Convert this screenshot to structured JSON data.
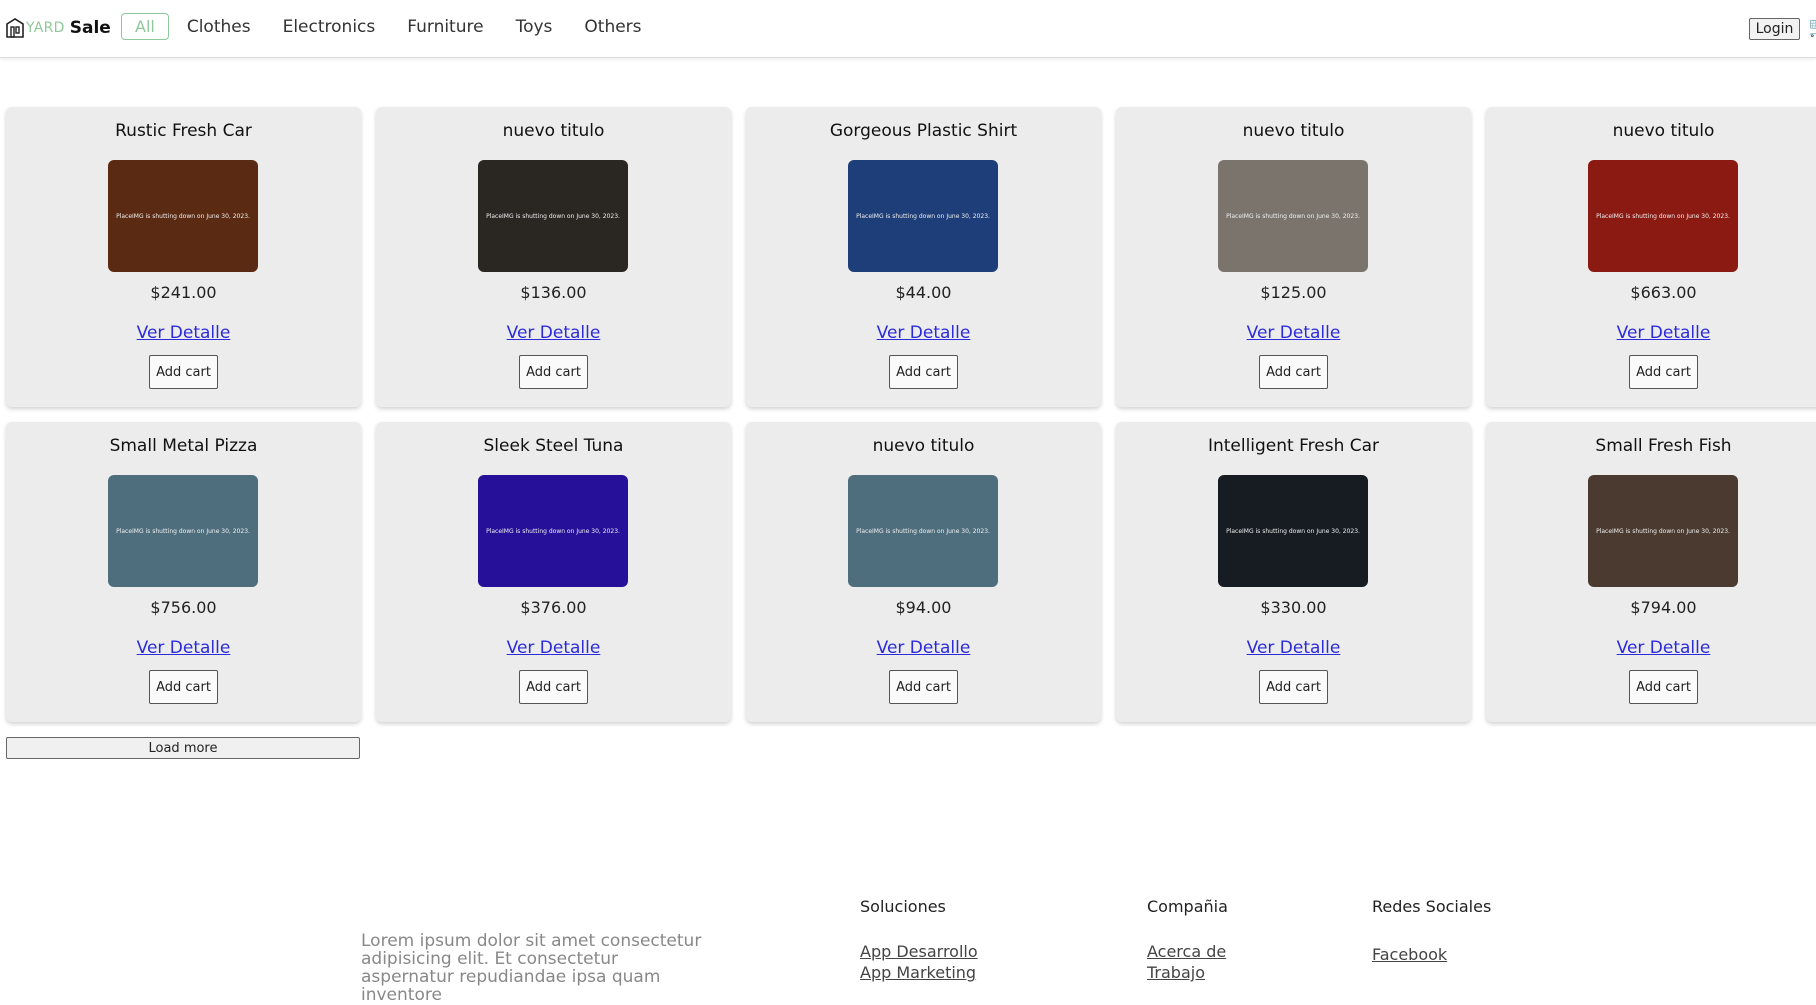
{
  "header": {
    "logo_yard": "YARD",
    "logo_sale": "Sale",
    "nav": [
      "All",
      "Clothes",
      "Electronics",
      "Furniture",
      "Toys",
      "Others"
    ],
    "login": "Login"
  },
  "products": [
    {
      "title": "Rustic Fresh Car",
      "price": "$241.00",
      "link": "Ver Detalle",
      "button": "Add cart",
      "img_text": "PlaceIMG is shutting down on June 30, 2023.",
      "bg": "#5a2a12"
    },
    {
      "title": "nuevo titulo",
      "price": "$136.00",
      "link": "Ver Detalle",
      "button": "Add cart",
      "img_text": "PlaceIMG is shutting down on June 30, 2023.",
      "bg": "#2a2622"
    },
    {
      "title": "Gorgeous Plastic Shirt",
      "price": "$44.00",
      "link": "Ver Detalle",
      "button": "Add cart",
      "img_text": "PlaceIMG is shutting down on June 30, 2023.",
      "bg": "#1d3e78"
    },
    {
      "title": "nuevo titulo",
      "price": "$125.00",
      "link": "Ver Detalle",
      "button": "Add cart",
      "img_text": "PlaceIMG is shutting down on June 30, 2023.",
      "bg": "#7a746c"
    },
    {
      "title": "nuevo titulo",
      "price": "$663.00",
      "link": "Ver Detalle",
      "button": "Add cart",
      "img_text": "PlaceIMG is shutting down on June 30, 2023.",
      "bg": "#8a1a12"
    },
    {
      "title": "Small Metal Pizza",
      "price": "$756.00",
      "link": "Ver Detalle",
      "button": "Add cart",
      "img_text": "PlaceIMG is shutting down on June 30, 2023.",
      "bg": "#4e6e7e"
    },
    {
      "title": "Sleek Steel Tuna",
      "price": "$376.00",
      "link": "Ver Detalle",
      "button": "Add cart",
      "img_text": "PlaceIMG is shutting down on June 30, 2023.",
      "bg": "#26109a"
    },
    {
      "title": "nuevo titulo",
      "price": "$94.00",
      "link": "Ver Detalle",
      "button": "Add cart",
      "img_text": "PlaceIMG is shutting down on June 30, 2023.",
      "bg": "#4e6e7e"
    },
    {
      "title": "Intelligent Fresh Car",
      "price": "$330.00",
      "link": "Ver Detalle",
      "button": "Add cart",
      "img_text": "PlaceIMG is shutting down on June 30, 2023.",
      "bg": "#161c22"
    },
    {
      "title": "Small Fresh Fish",
      "price": "$794.00",
      "link": "Ver Detalle",
      "button": "Add cart",
      "img_text": "PlaceIMG is shutting down on June 30, 2023.",
      "bg": "#4a3a30"
    }
  ],
  "load_more": "Load more",
  "footer": {
    "description": "Lorem ipsum dolor sit amet consectetur adipisicing elit. Et consectetur aspernatur repudiandae ipsa quam inventore",
    "columns": [
      {
        "title": "Soluciones",
        "links": [
          "App Desarrollo",
          "App Marketing"
        ]
      },
      {
        "title": "Compañia",
        "links": [
          "Acerca de Trabajo"
        ]
      },
      {
        "title": "Redes Sociales",
        "links": [
          "Facebook"
        ]
      }
    ]
  }
}
